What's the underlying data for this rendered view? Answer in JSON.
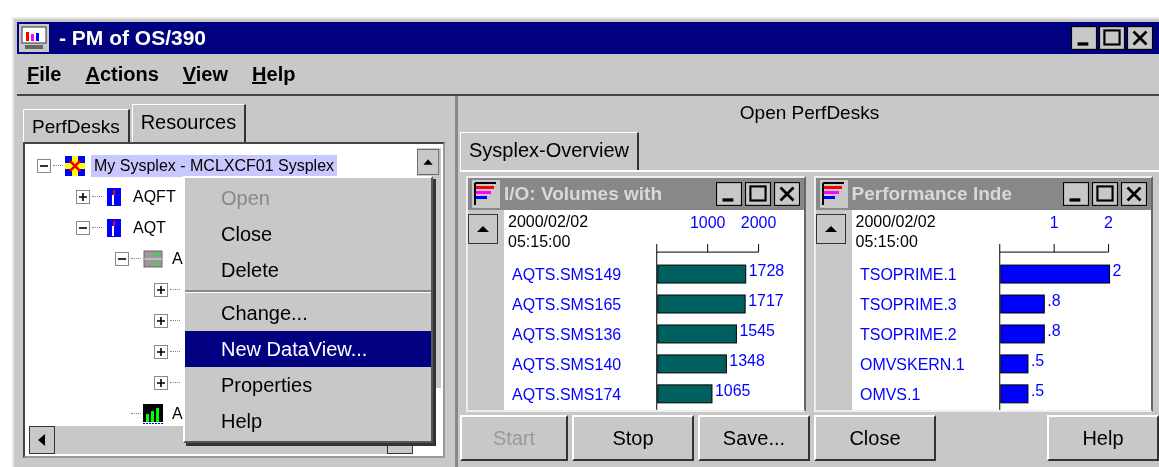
{
  "window": {
    "title": "- PM of OS/390"
  },
  "menu": [
    {
      "label": "File"
    },
    {
      "label": "Actions"
    },
    {
      "label": "View"
    },
    {
      "label": "Help"
    }
  ],
  "left_tabs": [
    {
      "label": "PerfDesks",
      "selected": false
    },
    {
      "label": "Resources",
      "selected": true
    }
  ],
  "tree": [
    {
      "label": "My Sysplex - MCLXCF01 Sysplex",
      "kind": "sysplex",
      "expanded": true,
      "selected": true,
      "children": [
        {
          "label": "AQFT",
          "kind": "system",
          "expanded": false,
          "selected": false
        },
        {
          "label": "AQT",
          "kind": "system",
          "expanded": true,
          "selected": false,
          "children": [
            {
              "label": "A",
              "kind": "group",
              "expanded": true,
              "selected": false,
              "children": [
                {
                  "expanded": false
                },
                {
                  "expanded": false
                },
                {
                  "expanded": false
                },
                {
                  "expanded": false
                }
              ]
            },
            {
              "label": "A",
              "kind": "chart",
              "selected": false
            }
          ]
        }
      ]
    }
  ],
  "context_menu": [
    {
      "kind": "item",
      "label": "Open",
      "disabled": true,
      "selected": false
    },
    {
      "kind": "item",
      "label": "Close",
      "disabled": false,
      "selected": false
    },
    {
      "kind": "item",
      "label": "Delete",
      "disabled": false,
      "selected": false
    },
    {
      "kind": "separator"
    },
    {
      "kind": "item",
      "label": "Change...",
      "disabled": false,
      "selected": false
    },
    {
      "kind": "item",
      "label": "New DataView...",
      "disabled": false,
      "selected": true
    },
    {
      "kind": "item",
      "label": "Properties",
      "disabled": false,
      "selected": false
    },
    {
      "kind": "item",
      "label": "Help",
      "disabled": false,
      "selected": false
    }
  ],
  "right_panel": {
    "title": "Open PerfDesks",
    "tabs": [
      {
        "label": "Sysplex-Overview",
        "selected": true
      }
    ],
    "dataviews": [
      {
        "title": "I/O: Volumes with",
        "timestamp": [
          "2000/02/02",
          "05:15:00"
        ],
        "chart_data": {
          "type": "bar",
          "orientation": "horizontal",
          "categories": [
            "AQTS.SMS149",
            "AQTS.SMS165",
            "AQTS.SMS136",
            "AQTS.SMS140",
            "AQTS.SMS174"
          ],
          "series": [
            {
              "color": "#005f5f",
              "values": [
                1728,
                1717,
                1545,
                1348,
                1065
              ]
            }
          ],
          "xticks": [
            1000,
            2000
          ],
          "xlim": [
            0,
            2000
          ],
          "value_labels": [
            "1728",
            "1717",
            "1545",
            "1348",
            "1065"
          ]
        }
      },
      {
        "title": "Performance Inde",
        "timestamp": [
          "2000/02/02",
          "05:15:00"
        ],
        "chart_data": {
          "type": "bar",
          "orientation": "horizontal",
          "categories": [
            "TSOPRIME.1",
            "TSOPRIME.3",
            "TSOPRIME.2",
            "OMVSKERN.1",
            "OMVS.1"
          ],
          "series": [
            {
              "color": "#0000ff",
              "values": [
                2,
                0.8,
                0.8,
                0.5,
                0.5
              ]
            }
          ],
          "xticks": [
            1,
            2
          ],
          "xlim": [
            0,
            2
          ],
          "value_labels": [
            "2",
            ".8",
            ".8",
            ".5",
            ".5"
          ]
        }
      }
    ],
    "buttons": [
      {
        "label": "Start",
        "disabled": true
      },
      {
        "label": "Stop",
        "disabled": false
      },
      {
        "label": "Save...",
        "disabled": false
      },
      {
        "label": "Close",
        "disabled": false
      },
      {
        "label": "Help",
        "disabled": false
      }
    ]
  }
}
